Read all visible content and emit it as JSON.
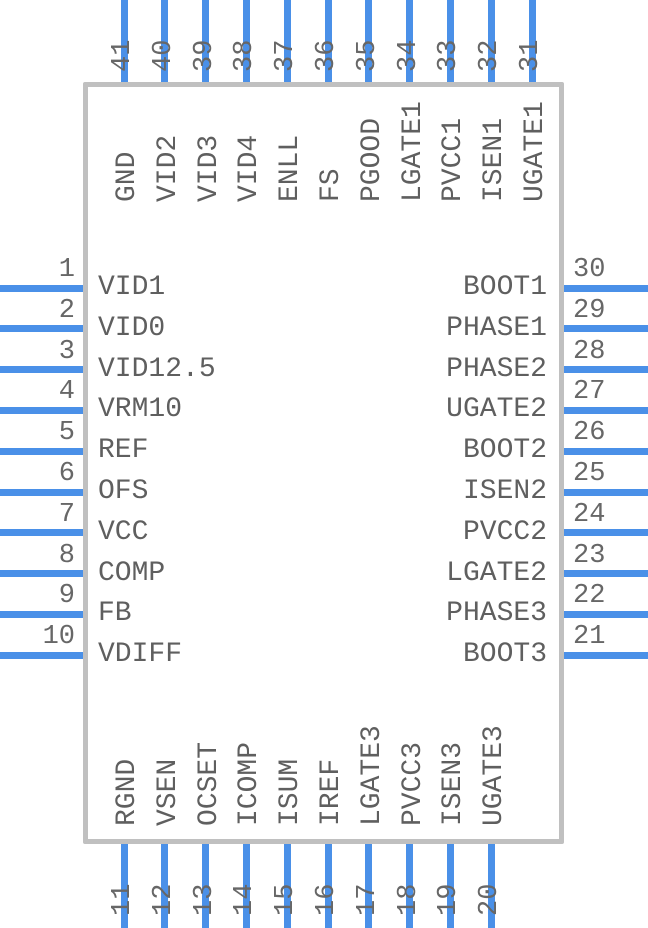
{
  "diagram": {
    "kind": "ic-pinout",
    "package_outline_color": "#c0c0c0",
    "pin_color": "#4a90e8",
    "text_color": "#5f5f5f",
    "number_color": "#676767",
    "background_color": "#ffffff"
  },
  "pins": {
    "left": [
      {
        "number": "1",
        "name": "VID1"
      },
      {
        "number": "2",
        "name": "VID0"
      },
      {
        "number": "3",
        "name": "VID12.5"
      },
      {
        "number": "4",
        "name": "VRM10"
      },
      {
        "number": "5",
        "name": "REF"
      },
      {
        "number": "6",
        "name": "OFS"
      },
      {
        "number": "7",
        "name": "VCC"
      },
      {
        "number": "8",
        "name": "COMP"
      },
      {
        "number": "9",
        "name": "FB"
      },
      {
        "number": "10",
        "name": "VDIFF"
      }
    ],
    "bottom": [
      {
        "number": "11",
        "name": "RGND"
      },
      {
        "number": "12",
        "name": "VSEN"
      },
      {
        "number": "13",
        "name": "OCSET"
      },
      {
        "number": "14",
        "name": "ICOMP"
      },
      {
        "number": "15",
        "name": "ISUM"
      },
      {
        "number": "16",
        "name": "IREF"
      },
      {
        "number": "17",
        "name": "LGATE3"
      },
      {
        "number": "18",
        "name": "PVCC3"
      },
      {
        "number": "19",
        "name": "ISEN3"
      },
      {
        "number": "20",
        "name": "UGATE3"
      }
    ],
    "right": [
      {
        "number": "21",
        "name": "BOOT3"
      },
      {
        "number": "22",
        "name": "PHASE3"
      },
      {
        "number": "23",
        "name": "LGATE2"
      },
      {
        "number": "24",
        "name": "PVCC2"
      },
      {
        "number": "25",
        "name": "ISEN2"
      },
      {
        "number": "26",
        "name": "BOOT2"
      },
      {
        "number": "27",
        "name": "UGATE2"
      },
      {
        "number": "28",
        "name": "PHASE2"
      },
      {
        "number": "29",
        "name": "PHASE1"
      },
      {
        "number": "30",
        "name": "BOOT1"
      }
    ],
    "top": [
      {
        "number": "31",
        "name": "UGATE1"
      },
      {
        "number": "32",
        "name": "ISEN1"
      },
      {
        "number": "33",
        "name": "PVCC1"
      },
      {
        "number": "34",
        "name": "LGATE1"
      },
      {
        "number": "35",
        "name": "PGOOD"
      },
      {
        "number": "36",
        "name": "FS"
      },
      {
        "number": "37",
        "name": "ENLL"
      },
      {
        "number": "38",
        "name": "VID4"
      },
      {
        "number": "39",
        "name": "VID3"
      },
      {
        "number": "40",
        "name": "VID2"
      },
      {
        "number": "41",
        "name": "GND"
      }
    ]
  }
}
